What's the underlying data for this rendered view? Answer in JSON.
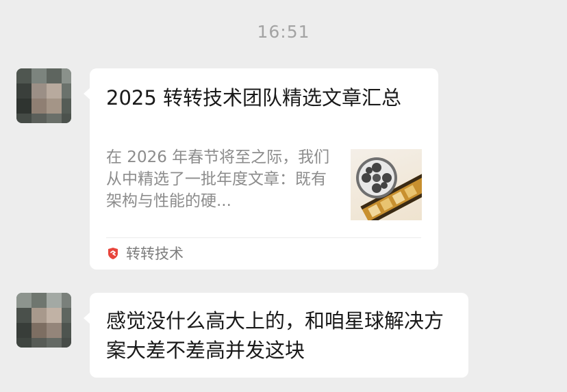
{
  "chat": {
    "timestamp": "16:51",
    "article_card": {
      "title": "2025 转转技术团队精选文章汇总",
      "description": "在 2026 年春节将至之际，我们从中精选了一批年度文章：既有架构与性能的硬...",
      "source_name": "转转技术",
      "thumbnail_icon": "film-reel-icon",
      "source_icon": "zhuanzhuan-logo-icon"
    },
    "message": {
      "text": "感觉没什么高大上的，和咱星球解决方案大差不差高并发这块"
    }
  },
  "colors": {
    "background": "#ededed",
    "bubble": "#ffffff",
    "primary_text": "#191919",
    "secondary_text": "#8c8c8c",
    "source_brand": "#e8453c"
  }
}
